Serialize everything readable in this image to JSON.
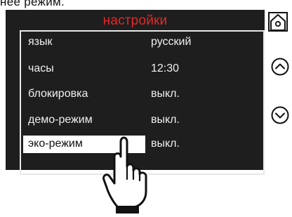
{
  "top_text": "нее режим.",
  "screen": {
    "title": "настройки",
    "title_color": "#e02a2a",
    "menu": [
      {
        "label": "язык",
        "value": "русский",
        "selected": false
      },
      {
        "label": "часы",
        "value": "12:30",
        "selected": false
      },
      {
        "label": "блокировка",
        "value": "выкл.",
        "selected": false
      },
      {
        "label": "демо-режим",
        "value": "выкл.",
        "selected": false
      },
      {
        "label": "эко-режим",
        "value": "выкл.",
        "selected": true
      }
    ]
  },
  "side_buttons": {
    "home": "home-icon",
    "up": "chevron-up-icon",
    "down": "chevron-down-icon"
  },
  "pointer": "hand-pointer-icon"
}
